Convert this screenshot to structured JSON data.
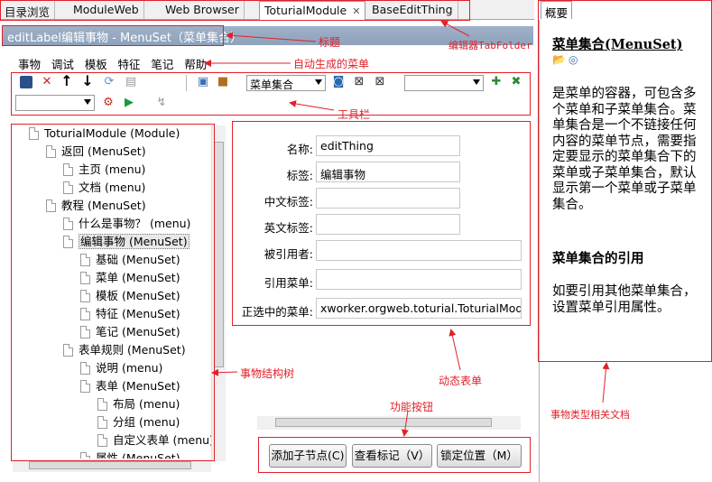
{
  "tabs": [
    {
      "label": "目录浏览"
    },
    {
      "label": "ModuleWeb"
    },
    {
      "label": "Web Browser"
    },
    {
      "label": "ToturialModule"
    },
    {
      "label": "BaseEditThing"
    }
  ],
  "title_bar": "editLabel编辑事物 - MenuSet（菜单集合）",
  "menu": [
    "事物",
    "调试",
    "模板",
    "特征",
    "笔记",
    "帮助"
  ],
  "toolbar": {
    "combo_selected": "菜单集合"
  },
  "tree": [
    {
      "label": "ToturialModule (Module)"
    },
    {
      "label": "返回 (MenuSet)"
    },
    {
      "label": "主页 (menu)"
    },
    {
      "label": "文档 (menu)"
    },
    {
      "label": "教程 (MenuSet)"
    },
    {
      "label": "什么是事物？ (menu)"
    },
    {
      "label": "编辑事物 (MenuSet)"
    },
    {
      "label": "基础 (MenuSet)"
    },
    {
      "label": "菜单 (MenuSet)"
    },
    {
      "label": "模板 (MenuSet)"
    },
    {
      "label": "特征 (MenuSet)"
    },
    {
      "label": "笔记 (MenuSet)"
    },
    {
      "label": "表单规则 (MenuSet)"
    },
    {
      "label": "说明 (menu)"
    },
    {
      "label": "表单 (MenuSet)"
    },
    {
      "label": "布局 (menu)"
    },
    {
      "label": "分组 (menu)"
    },
    {
      "label": "自定义表单 (menu)"
    },
    {
      "label": "属性 (MenuSet)"
    }
  ],
  "form": {
    "fields": [
      {
        "label": "名称:",
        "value": "editThing"
      },
      {
        "label": "标签:",
        "value": "编辑事物"
      },
      {
        "label": "中文标签:",
        "value": ""
      },
      {
        "label": "英文标签:",
        "value": ""
      },
      {
        "label": "被引用者:",
        "value": ""
      },
      {
        "label": "引用菜单:",
        "value": ""
      },
      {
        "label": "正选中的菜单:",
        "value": "xworker.orgweb.toturial.ToturialModu"
      }
    ],
    "buttons": [
      "添加子节点(C)",
      "查看标记（V）",
      "锁定位置（M）"
    ]
  },
  "annotations": {
    "title": "标题",
    "editor_tabfolder": "编辑器TabFolder",
    "auto_menu": "自动生成的菜单",
    "toolbar": "工具栏",
    "tree": "事物结构树",
    "dynamic_form": "动态表单",
    "function_buttons": "功能按钮",
    "doc": "事物类型相关文档"
  },
  "doc": {
    "tab": "概要",
    "heading": "菜单集合(MenuSet)",
    "para1": "是菜单的容器，可包含多个菜单和子菜单集合。菜单集合是一个不链接任何内容的菜单节点，需要指定要显示的菜单集合下的菜单或子菜单集合，默认显示第一个菜单或子菜单集合。",
    "heading2": "菜单集合的引用",
    "para2": "如要引用其他菜单集合，设置菜单引用属性。"
  },
  "colors": {
    "annotation": "#e0202a",
    "title_bar": "#9fb1c8"
  }
}
